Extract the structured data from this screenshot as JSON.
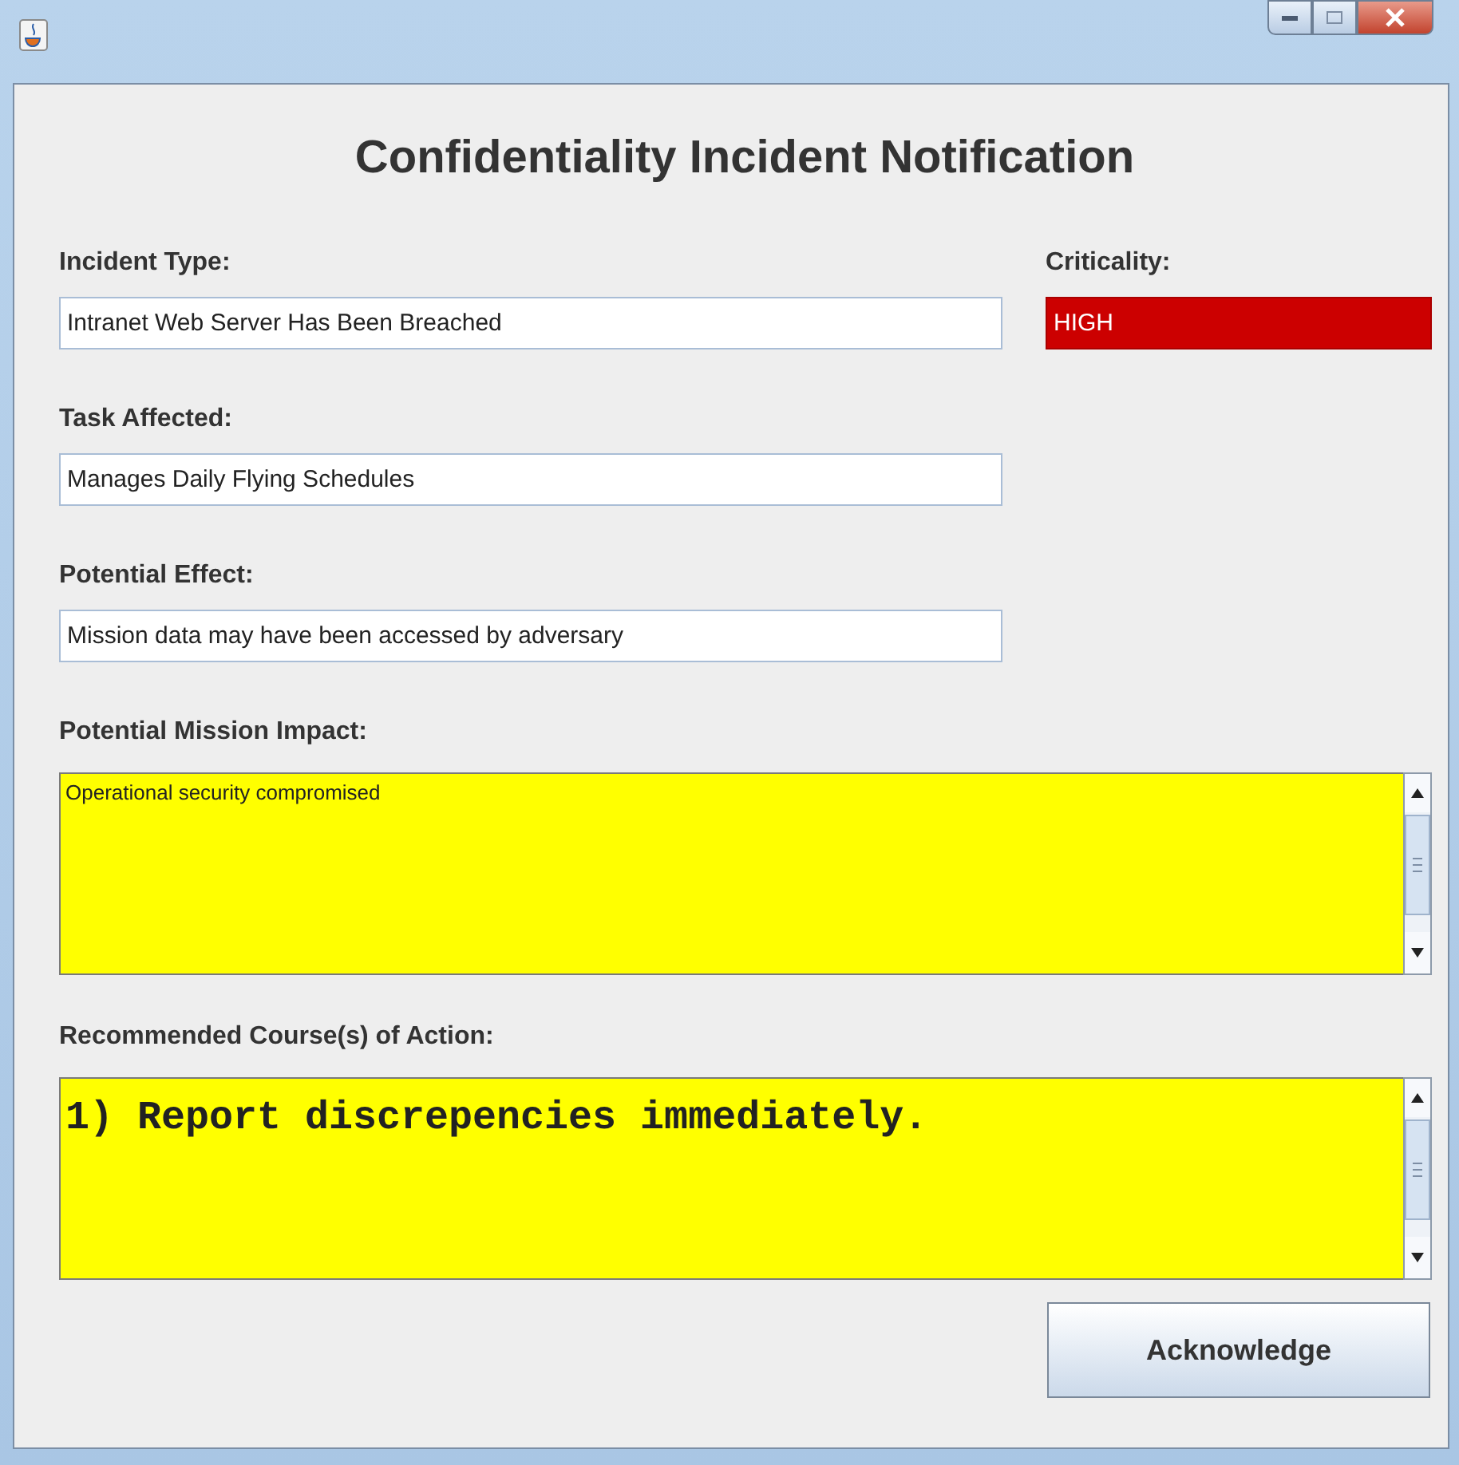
{
  "heading": "Confidentiality Incident Notification",
  "fields": [
    {
      "label": "Incident Type:",
      "value": "Intranet Web Server Has Been Breached"
    },
    {
      "label": "Task Affected:",
      "value": "Manages Daily Flying Schedules"
    },
    {
      "label": "Potential Effect:",
      "value": "Mission data may have been accessed by adversary"
    }
  ],
  "criticality": {
    "label": "Criticality:",
    "value": "HIGH"
  },
  "text_areas": [
    {
      "label": "Potential Mission Impact:",
      "value": "Operational security compromised",
      "kind": "plain"
    },
    {
      "label": "Recommended Course(s) of Action:",
      "value": "1) Report discrepencies immediately.",
      "kind": "mono"
    }
  ],
  "button": "Acknowledge"
}
